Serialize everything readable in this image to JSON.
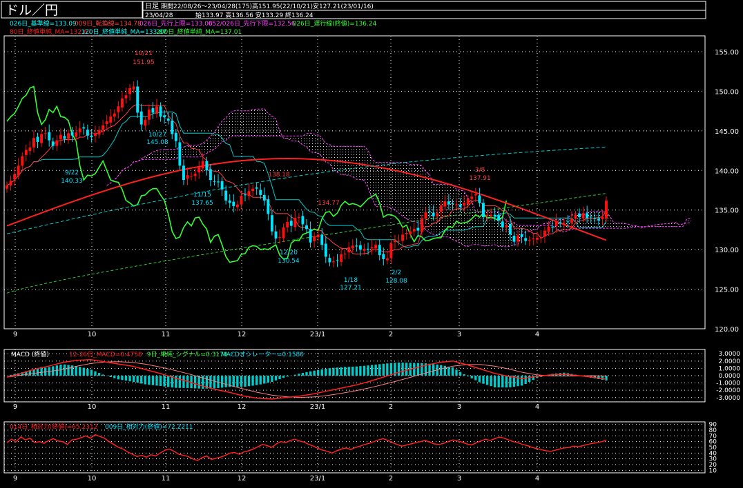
{
  "header": {
    "title": "ドル／円",
    "period_type": "日足",
    "summary_line": "期間22/08/26〜23/04/28(175)高151.95(22/10/21)安127.21(23/01/16)",
    "date": "23/04/28",
    "ohlc": "始133.97 高136.56 安133.29 終136.24"
  },
  "legend": {
    "row1": [
      {
        "text": "026日_基準線=133.09",
        "color": "#00ffff"
      },
      {
        "text": "009日_転換線=134.78",
        "color": "#ff4040"
      },
      {
        "text": "026日_先行上限=133.06",
        "color": "#ff40ff"
      },
      {
        "text": "052/026日_先行下限=132.56",
        "color": "#ff40ff"
      },
      {
        "text": "026日_遅行線(終値)=136.24",
        "color": "#33ff33"
      }
    ],
    "row2": [
      {
        "text": "80日_終値単純_MA=132.67",
        "color": "#ff2020"
      },
      {
        "text": "120日_終値単純_MA=133.87",
        "color": "#00ffff"
      },
      {
        "text": "200日_終値単純_MA=137.01",
        "color": "#33ff33"
      }
    ]
  },
  "colors": {
    "bull": "#ff1010",
    "bear": "#00e5ff",
    "kijun": "#00cccc",
    "tenkan": "#ff4040",
    "chikou": "#33ff33",
    "cloud": "#ff40ff",
    "ma80": "#ff2020",
    "ma120": "#00cccc",
    "ma200": "#33cc33",
    "macd": "#ff2020",
    "signal": "#ff2020",
    "hist": "#00cccc",
    "rsi": "#ff2020"
  },
  "chart_data": [
    {
      "type": "candlestick",
      "title": "ドル／円",
      "x_ticks": [
        "9",
        "10",
        "11",
        "12",
        "23/1",
        "2",
        "3",
        "4"
      ],
      "y_ticks": [
        "155.00",
        "150.00",
        "145.00",
        "140.00",
        "135.00",
        "130.00",
        "125.00",
        "120.00"
      ],
      "ylim": [
        120,
        157
      ],
      "grid": true,
      "annotations": [
        {
          "text": "10/21",
          "date": "22/10/21",
          "value": 151.95
        },
        {
          "text": "151.95",
          "date": "22/10/21",
          "value": 151.95
        },
        {
          "text": "10/27",
          "date": "22/10/27",
          "value": 145.08
        },
        {
          "text": "145.08",
          "date": "22/10/27",
          "value": 145.08
        },
        {
          "text": "9/22",
          "date": "22/09/22",
          "value": 140.33
        },
        {
          "text": "140.33",
          "date": "22/09/22",
          "value": 140.33
        },
        {
          "text": "11/15",
          "date": "22/11/15",
          "value": 137.65
        },
        {
          "text": "137.65",
          "date": "22/11/15",
          "value": 137.65
        },
        {
          "text": "138.18",
          "date": "22/12/15",
          "value": 138.18
        },
        {
          "text": "134.77",
          "date": "22/12/27",
          "value": 134.77
        },
        {
          "text": "12/20",
          "date": "22/12/20",
          "value": 130.54
        },
        {
          "text": "130.54",
          "date": "22/12/20",
          "value": 130.54
        },
        {
          "text": "1/18",
          "date": "23/01/18",
          "value": 127.21
        },
        {
          "text": "127.21",
          "date": "23/01/18",
          "value": 127.21
        },
        {
          "text": "2/2",
          "date": "23/02/02",
          "value": 128.08
        },
        {
          "text": "128.08",
          "date": "23/02/02",
          "value": 128.08
        },
        {
          "text": "3/8",
          "date": "23/03/08",
          "value": 137.91
        },
        {
          "text": "137.91",
          "date": "23/03/08",
          "value": 137.91
        }
      ],
      "series": [
        {
          "name": "終値",
          "values": [
            138.1,
            138.7,
            139.5,
            140.6,
            141.8,
            142.6,
            142.9,
            144.1,
            143.6,
            144.6,
            144.7,
            143.8,
            143.1,
            143.8,
            144.5,
            144.0,
            144.7,
            144.4,
            144.8,
            145.3,
            145.3,
            144.4,
            144.2,
            144.7,
            145.1,
            145.7,
            146.2,
            146.8,
            147.2,
            148.1,
            149.1,
            149.5,
            150.4,
            150.6,
            147.3,
            145.8,
            146.4,
            147.7,
            147.3,
            148.1,
            146.8,
            146.7,
            146.3,
            144.6,
            143.7,
            140.6,
            138.8,
            139.4,
            139.3,
            139.6,
            140.4,
            141.2,
            140.0,
            138.8,
            138.6,
            138.5,
            137.6,
            136.2,
            135.9,
            135.5,
            135.7,
            136.8,
            136.9,
            137.4,
            137.7,
            137.7,
            136.9,
            136.2,
            134.5,
            132.3,
            131.4,
            131.6,
            132.8,
            133.5,
            133.0,
            134.0,
            134.1,
            133.2,
            132.6,
            130.9,
            131.7,
            131.9,
            130.6,
            129.1,
            128.4,
            128.5,
            128.6,
            129.4,
            129.5,
            130.3,
            130.5,
            130.4,
            130.0,
            130.1,
            130.0,
            130.3,
            130.6,
            129.3,
            128.8,
            128.9,
            130.8,
            131.2,
            131.1,
            131.9,
            132.1,
            132.3,
            132.6,
            132.4,
            133.9,
            134.7,
            134.8,
            134.2,
            134.6,
            135.6,
            136.1,
            135.7,
            135.8,
            135.7,
            135.4,
            135.9,
            136.4,
            136.7,
            137.0,
            135.9,
            134.1,
            134.4,
            134.4,
            134.2,
            133.7,
            132.8,
            133.1,
            131.9,
            131.0,
            131.8,
            131.6,
            131.1,
            131.2,
            131.4,
            131.5,
            131.5,
            132.4,
            132.9,
            132.8,
            133.6,
            133.3,
            133.4,
            133.5,
            133.9,
            134.4,
            134.1,
            134.6,
            134.0,
            134.1,
            133.9,
            133.7,
            134.1,
            136.2
          ]
        },
        {
          "name": "9日 単純",
          "values": [
            -0.2,
            0.3,
            0.9,
            1.3,
            1.8,
            2.1,
            2.2,
            1.9,
            1.6,
            1.3,
            0.8,
            0.3,
            -0.3,
            -0.8,
            -1.4,
            -1.9,
            -2.3,
            -2.8,
            -3.1,
            -3.2,
            -3.0,
            -2.8,
            -2.5,
            -2.1,
            -1.7,
            -1.3,
            -0.8,
            -0.2,
            0.4,
            0.9,
            1.4,
            1.8,
            2.0,
            1.5,
            0.9,
            0.3,
            -0.1,
            -0.4,
            -0.1,
            0.1,
            0.2,
            0.0,
            -0.2,
            -0.5
          ]
        },
        {
          "name": "相対力",
          "values": [
            58,
            64,
            60,
            68,
            63,
            66,
            58,
            60,
            57,
            62,
            65,
            61,
            60,
            55,
            63,
            64,
            67,
            70,
            66,
            72,
            69,
            66,
            60,
            55,
            50,
            47,
            42,
            38,
            34,
            36,
            33,
            37,
            35,
            40,
            45,
            47,
            43,
            38,
            36,
            34,
            30,
            27,
            32,
            35,
            29,
            31,
            33,
            36,
            40,
            41,
            38,
            42,
            44,
            47,
            51,
            55,
            53,
            50,
            56,
            60,
            58,
            62,
            64,
            61,
            59,
            55,
            52,
            48,
            45,
            43,
            40,
            44,
            47,
            49,
            46,
            50,
            52,
            55,
            57,
            60,
            63,
            65,
            62,
            58,
            55,
            52,
            54,
            56,
            58,
            60,
            62,
            59,
            56,
            55,
            57,
            60,
            63,
            61,
            59,
            56,
            54,
            58,
            61,
            64,
            62,
            65,
            68,
            66,
            63,
            60,
            58,
            55,
            53,
            50,
            48,
            46,
            44,
            43,
            45,
            47,
            49,
            50,
            52,
            51,
            53,
            55,
            57,
            58,
            60,
            62
          ]
        }
      ]
    },
    {
      "type": "line",
      "title": "MACD (終値)",
      "legend": [
        "12-26日_MACD=0.4758",
        "9日_単純_シグナル=0.3178",
        "MACDオシレーター=0.1580"
      ],
      "x_ticks": [
        "9",
        "10",
        "11",
        "12",
        "23/1",
        "2",
        "3",
        "4"
      ],
      "y_ticks": [
        "3.0000",
        "2.0000",
        "1.0000",
        "0.0000",
        "-1.0000",
        "-2.0000",
        "-3.0000"
      ],
      "ylim": [
        -3.4,
        3.4
      ],
      "grid": true
    },
    {
      "type": "line",
      "title": "相対力 (終値)",
      "legend": [
        "014日_相対力(終値)=65.2312",
        "009日_相対力(終値)=72.2211"
      ],
      "x_ticks": [
        "9",
        "10",
        "11",
        "12",
        "23/1",
        "2",
        "3",
        "4"
      ],
      "y_ticks": [
        "90",
        "80",
        "70",
        "60",
        "50",
        "40",
        "30",
        "20",
        "10"
      ],
      "ylim": [
        8,
        92
      ],
      "grid": true
    }
  ]
}
